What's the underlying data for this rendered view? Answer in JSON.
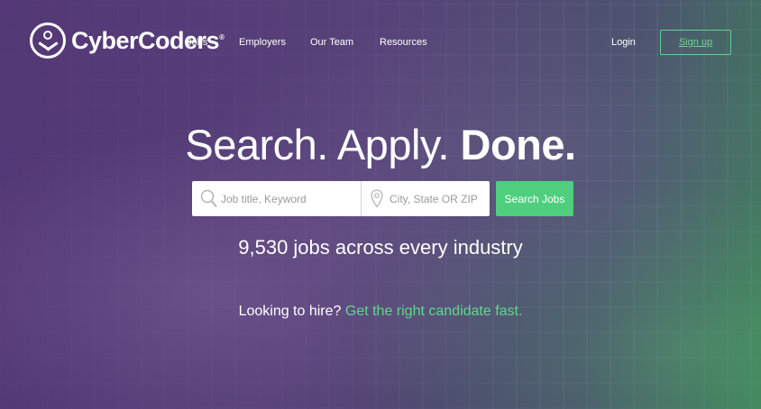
{
  "brand": {
    "name": "CyberCoders",
    "mark": "®"
  },
  "nav": {
    "items": [
      "Jobs",
      "Employers",
      "Our Team",
      "Resources"
    ],
    "login": "Login",
    "signup": "Sign up"
  },
  "hero": {
    "headline_part1": "Search. Apply. ",
    "headline_bold": "Done.",
    "keyword_placeholder": "Job title, Keyword",
    "location_placeholder": "City, State OR ZIP",
    "search_button": "Search Jobs",
    "jobs_count": "9,530 jobs across every industry",
    "hire_prompt": "Looking to hire? ",
    "hire_link": "Get the right candidate fast."
  },
  "colors": {
    "accent": "#4fcf7e",
    "overlay": "#543778"
  },
  "icons": {
    "keyword": "search-icon",
    "location": "map-pin-icon"
  }
}
